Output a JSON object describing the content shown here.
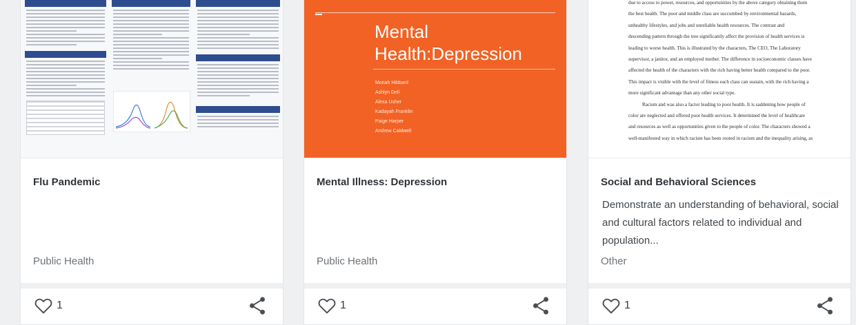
{
  "cards": [
    {
      "title": "Flu Pandemic",
      "description": "",
      "category": "Public Health",
      "likes": "1"
    },
    {
      "title": "Mental Illness: Depression",
      "description": "",
      "category": "Public Health",
      "likes": "1",
      "slide": {
        "title": "Mental Health:Depression",
        "authors": [
          "Moriah Hibbard",
          "Ashlyn Dell",
          "Alexa Usher",
          "Kadayah Franklin",
          "Paige Harper",
          "Andrew Caldwell"
        ]
      }
    },
    {
      "title": "Social and Behavioral Sciences",
      "description": "Demonstrate an understanding of behavioral, social and cultural factors related to individual and population...",
      "category": "Other",
      "likes": "1",
      "doc_lines": [
        "due to access to power, resources, and opportunities by the above category obtaining them",
        "the best health. The poor and middle class are succumbed by environmental hazards,",
        "unhealthy lifestyles, and jobs and unreliable health resources. The contrast and",
        "descending pattern through the tree significantly affect the provision of health services is",
        "leading to worse health. This is illustrated by the characters, The CEO, The Laboratory",
        "supervisor, a janitor, and an employed mother. The difference in socioeconomic classes have",
        "affected the health of the characters with the rich having better health compared to the poor.",
        "This impact is visible with the level of fitness each class can sustain, with the rich having a",
        "more significant advantage than any other social type.",
        "Racism and was also a factor leading to poor health. It is saddening how people of",
        "color are neglected and offered poor health services. It determined the level of healthcare",
        "and resources as well as opportunities given to the people of color. The characters showed a",
        "well-manifested way in which racism has been rooted in racism and the inequality arising, as"
      ]
    }
  ],
  "colors": {
    "slide_bg": "#f26225",
    "poster_header": "#2e4d8f",
    "title_text": "#2f3337",
    "category_text": "#6d7378",
    "icon": "#4a4f54"
  },
  "icons": {
    "like": "heart-outline-icon",
    "share": "share-icon"
  }
}
